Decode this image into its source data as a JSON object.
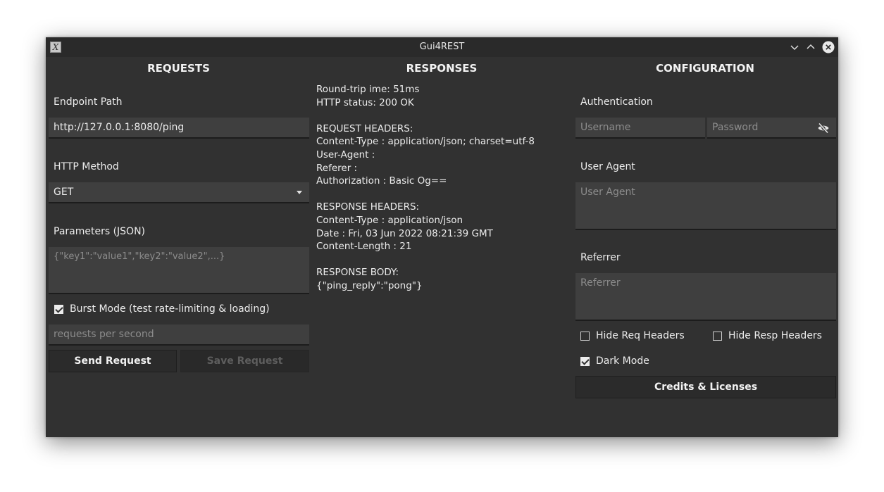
{
  "window": {
    "title": "Gui4REST"
  },
  "requests": {
    "heading": "REQUESTS",
    "endpoint_label": "Endpoint Path",
    "endpoint_value": "http://127.0.0.1:8080/ping",
    "method_label": "HTTP Method",
    "method_value": "GET",
    "params_label": "Parameters (JSON)",
    "params_placeholder": "{\"key1\":\"value1\",\"key2\":\"value2\",...}",
    "burst_label": "Burst Mode (test rate-limiting & loading)",
    "burst_checked": true,
    "rps_placeholder": "requests per second",
    "send_label": "Send Request",
    "save_label": "Save Request"
  },
  "responses": {
    "heading": "RESPONSES",
    "lines": [
      "Round-trip ime: 51ms",
      "HTTP status: 200 OK",
      "",
      "REQUEST HEADERS:",
      "Content-Type : application/json; charset=utf-8",
      "User-Agent :",
      "Referer :",
      "Authorization : Basic Og==",
      "",
      "RESPONSE HEADERS:",
      "Content-Type : application/json",
      "Date : Fri, 03 Jun 2022 08:21:39 GMT",
      "Content-Length : 21",
      "",
      "RESPONSE BODY:",
      "{\"ping_reply\":\"pong\"}"
    ]
  },
  "configuration": {
    "heading": "CONFIGURATION",
    "auth_label": "Authentication",
    "username_placeholder": "Username",
    "password_placeholder": "Password",
    "user_agent_label": "User Agent",
    "user_agent_placeholder": "User Agent",
    "referrer_label": "Referrer",
    "referrer_placeholder": "Referrer",
    "hide_req_headers_label": "Hide Req Headers",
    "hide_req_headers_checked": false,
    "hide_resp_headers_label": "Hide Resp Headers",
    "hide_resp_headers_checked": false,
    "dark_mode_label": "Dark Mode",
    "dark_mode_checked": true,
    "credits_label": "Credits & Licenses"
  }
}
